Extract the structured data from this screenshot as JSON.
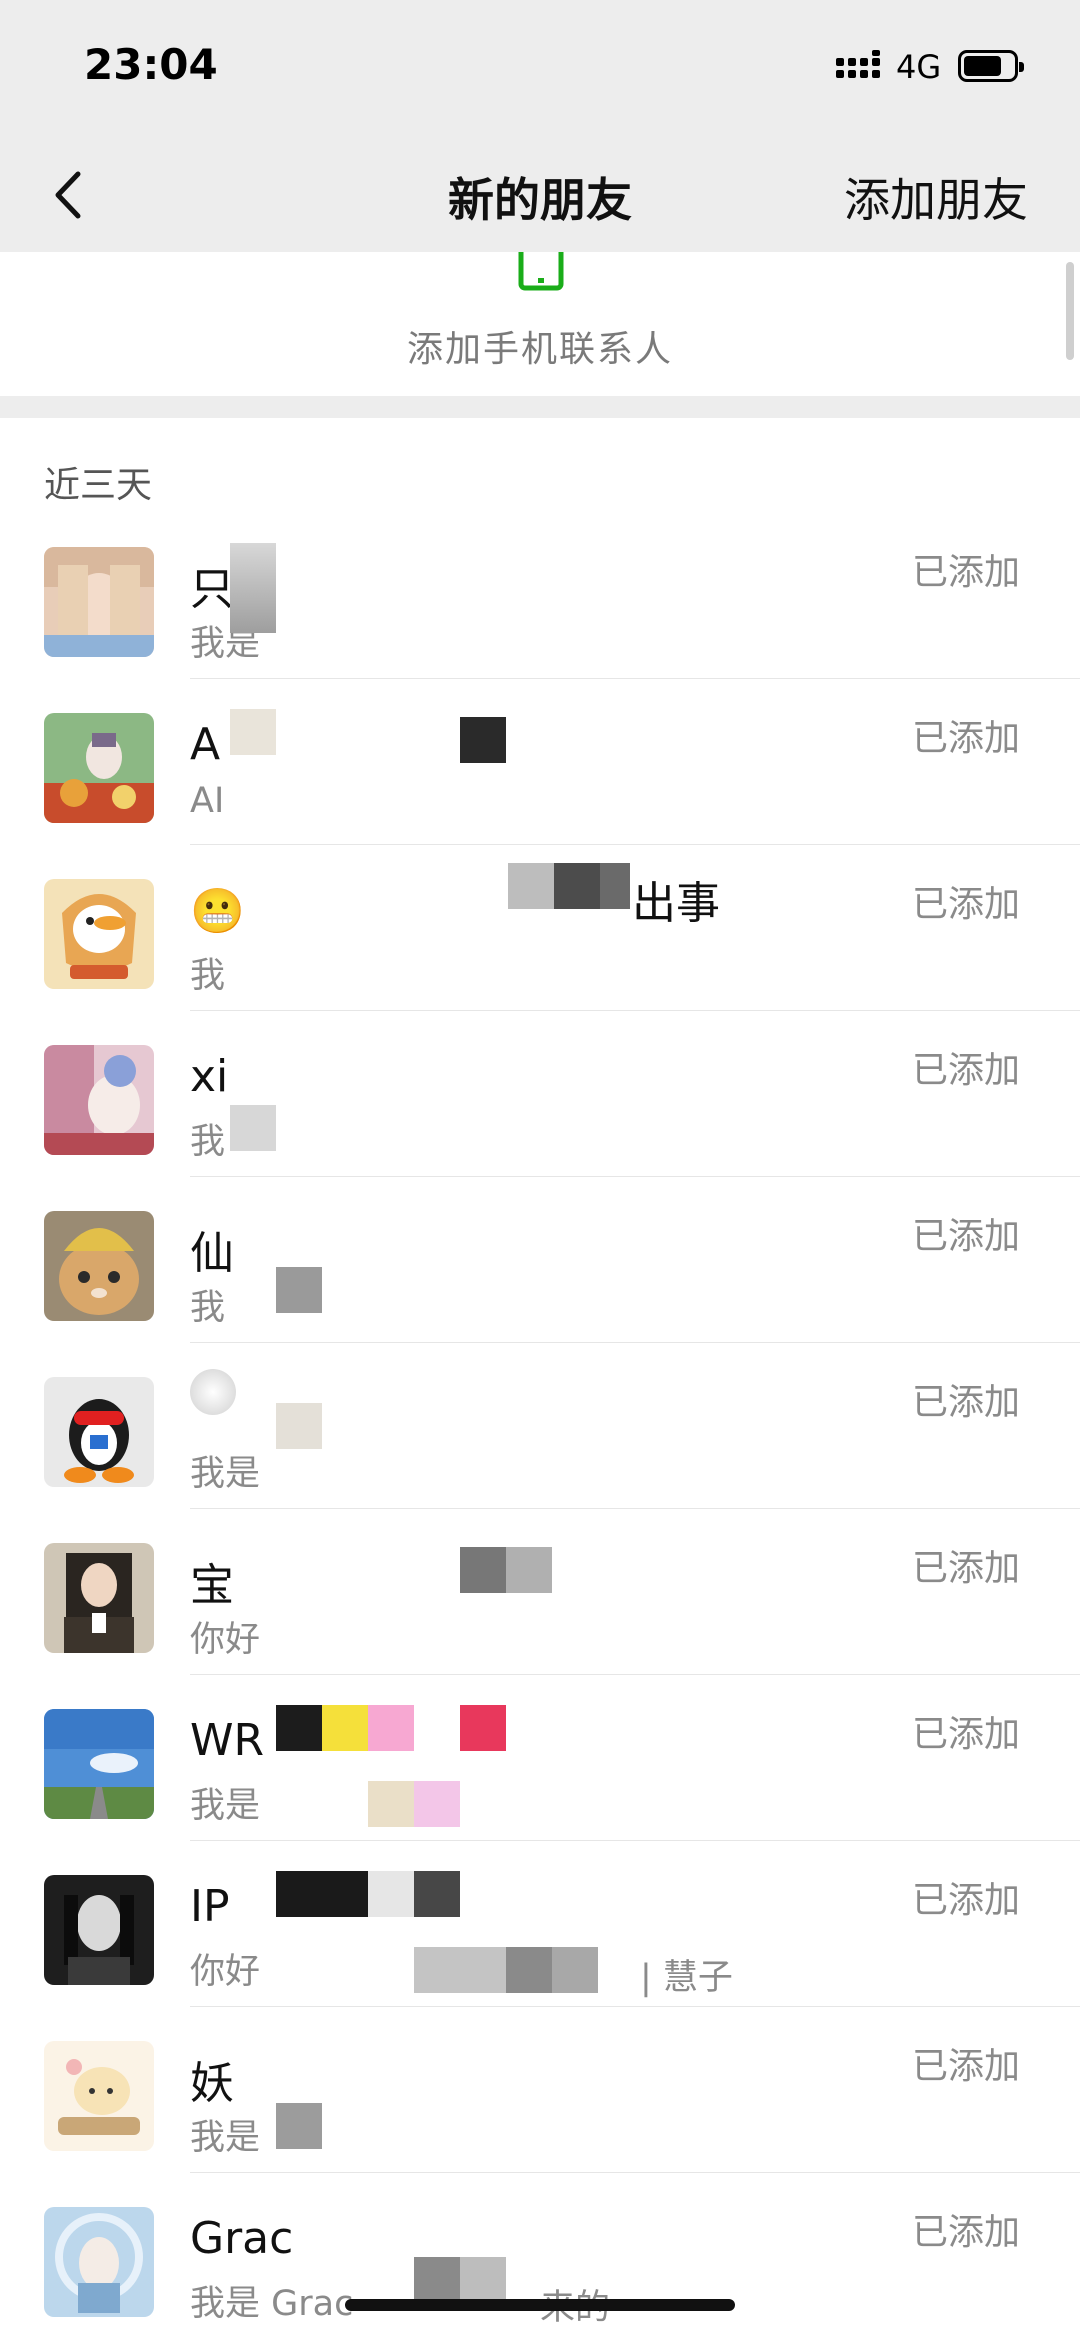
{
  "status_bar": {
    "time": "23:04",
    "network": "4G"
  },
  "nav": {
    "title": "新的朋友",
    "action": "添加朋友"
  },
  "phone_contacts": {
    "label": "添加手机联系人"
  },
  "section": {
    "title": "近三天"
  },
  "friends": [
    {
      "name": "只只",
      "message": "我是",
      "status": "已添加",
      "avatar": "avatar-girl-portrait"
    },
    {
      "name": "A",
      "message": "AI",
      "status": "已添加",
      "avatar": "avatar-anime-garden"
    },
    {
      "name": "😬",
      "message": "我",
      "status": "已添加",
      "avatar": "avatar-duck-sticker",
      "extra": "出事"
    },
    {
      "name": "xi",
      "message": "我",
      "status": "已添加",
      "avatar": "avatar-anime-girl"
    },
    {
      "name": "仙",
      "message": "我",
      "status": "已添加",
      "avatar": "avatar-cat-hat"
    },
    {
      "name": "",
      "message": "我是",
      "status": "已添加",
      "avatar": "avatar-penguin"
    },
    {
      "name": "宝",
      "message": "你好",
      "status": "已添加",
      "avatar": "avatar-woman-suit"
    },
    {
      "name": "WR",
      "message": "我是",
      "status": "已添加",
      "avatar": "avatar-sky-road"
    },
    {
      "name": "IP",
      "message": "你好",
      "status": "已添加",
      "avatar": "avatar-bw-portrait",
      "extra": "| 慧子"
    },
    {
      "name": "妖",
      "message": "我是",
      "status": "已添加",
      "avatar": "avatar-cartoon-tea"
    },
    {
      "name": "Grac",
      "message": "我是 Grac",
      "status": "已添加",
      "avatar": "avatar-moon-girl",
      "extra": "来的"
    }
  ],
  "colors": {
    "nav_bg": "#ededed",
    "accent_green": "#07c160",
    "text_secondary": "#8a8a8a"
  }
}
